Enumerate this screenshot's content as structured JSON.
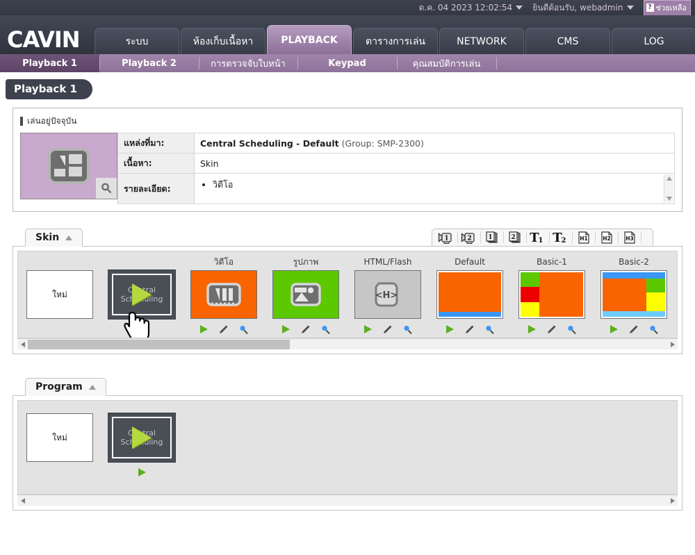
{
  "topbar": {
    "datetime": "ต.ค. 04 2023 12:02:54",
    "welcome": "ยินดีต้อนรับ, webadmin",
    "help_label": "ช่วยเหลือ",
    "help_mark": "?"
  },
  "brand": {
    "logo": "CAVIN"
  },
  "mainnav": {
    "tabs": [
      {
        "label": "ระบบ",
        "active": false
      },
      {
        "label": "ห้องเก็บเนื้อหา",
        "active": false
      },
      {
        "label": "PLAYBACK",
        "active": true
      },
      {
        "label": "ตารางการเล่น",
        "active": false
      },
      {
        "label": "NETWORK",
        "active": false
      },
      {
        "label": "CMS",
        "active": false
      },
      {
        "label": "LOG",
        "active": false
      }
    ]
  },
  "subnav": {
    "items": [
      {
        "label": "Playback 1",
        "active": true
      },
      {
        "label": "Playback 2",
        "active": false
      },
      {
        "label": "การตรวจจับใบหน้า",
        "active": false
      },
      {
        "label": "Keypad",
        "active": false
      },
      {
        "label": "คุณสมบัติการเล่น",
        "active": false
      }
    ]
  },
  "page": {
    "title": "Playback 1"
  },
  "now_playing": {
    "heading": "เล่นอยู่ปัจจุบัน",
    "rows": [
      {
        "label": "แหล่งที่มา:",
        "value_strong": "Central Scheduling - Default",
        "value_dim": "(Group: SMP-2300)"
      },
      {
        "label": "เนื้อหา:",
        "value": "Skin"
      }
    ],
    "detail_label": "รายละเอียด:",
    "detail_items": [
      "วิดีโอ"
    ]
  },
  "skin_section": {
    "tab_label": "Skin",
    "toolbar_icons": [
      "camera-1-icon",
      "camera-2-icon",
      "pages-1-icon",
      "pages-2-icon",
      "text-t1-icon",
      "text-t2-icon",
      "html-h1-icon",
      "html-h2-icon",
      "html-h3-icon"
    ],
    "cards": [
      {
        "caption": "",
        "type": "new",
        "label": "ใหม่",
        "actions": []
      },
      {
        "caption": "",
        "type": "central-scheduling",
        "label": "Central Scheduling",
        "actions": [
          "play"
        ]
      },
      {
        "caption": "วิดีโอ",
        "type": "media-video",
        "actions": [
          "play",
          "edit",
          "preview"
        ]
      },
      {
        "caption": "รูปภาพ",
        "type": "media-image",
        "actions": [
          "play",
          "edit",
          "preview"
        ]
      },
      {
        "caption": "HTML/Flash",
        "type": "media-html",
        "actions": [
          "play",
          "edit",
          "preview"
        ]
      },
      {
        "caption": "Default",
        "type": "layout-default",
        "actions": [
          "play",
          "edit",
          "preview"
        ]
      },
      {
        "caption": "Basic-1",
        "type": "layout-basic1",
        "actions": [
          "play",
          "edit",
          "preview"
        ]
      },
      {
        "caption": "Basic-2",
        "type": "layout-basic2",
        "actions": [
          "play",
          "edit",
          "preview"
        ]
      }
    ],
    "scroll": {
      "thumb_left_pct": 0,
      "thumb_width_pct": 41
    }
  },
  "program_section": {
    "tab_label": "Program",
    "cards": [
      {
        "caption": "",
        "type": "new",
        "label": "ใหม่",
        "actions": []
      },
      {
        "caption": "",
        "type": "central-scheduling",
        "label": "Central Scheduling",
        "actions": [
          "play"
        ]
      }
    ],
    "scroll": {
      "thumb_left_pct": 0,
      "thumb_width_pct": 0
    }
  },
  "colors": {
    "accent_purple": "#8e7299",
    "header_dark": "#393d49",
    "orange": "#f96400",
    "green": "#5cc800",
    "red": "#ee0000",
    "yellow": "#ffff00",
    "blue": "#3a97f5",
    "light_blue": "#6ecbf7",
    "play_green": "#5bb01e",
    "preview_blue": "#3a97f5"
  }
}
